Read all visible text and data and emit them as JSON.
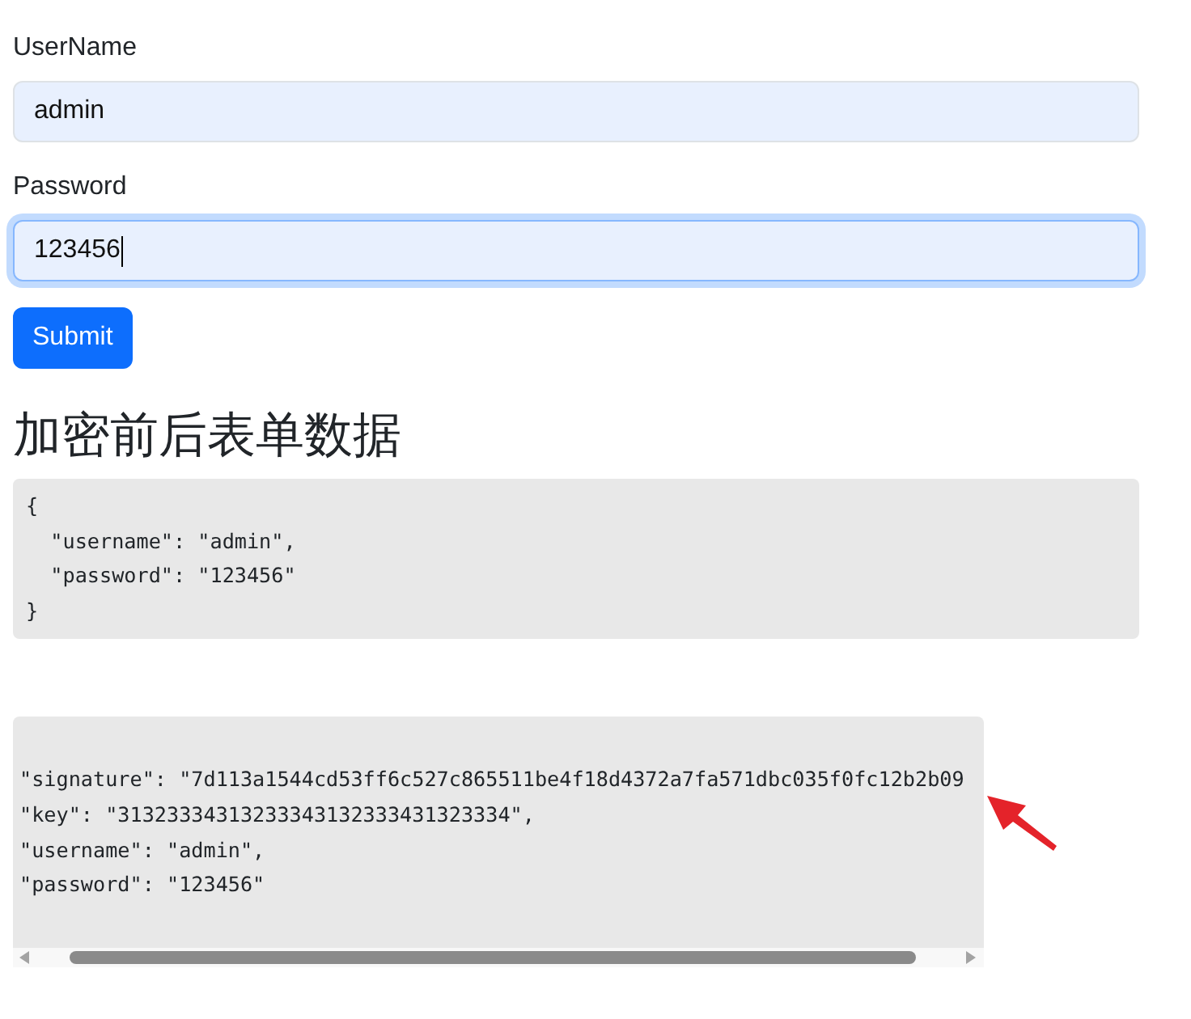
{
  "form": {
    "fields": [
      {
        "label": "UserName",
        "value": "admin",
        "focused": false
      },
      {
        "label": "Password",
        "value": "123456",
        "focused": true
      }
    ],
    "submit_button": "Submit"
  },
  "heading": "加密前后表单数据",
  "before_block": {
    "lines": [
      "{",
      "  \"username\": \"admin\",",
      "  \"password\": \"123456\"",
      "}"
    ]
  },
  "after_block": {
    "lines": [
      "\"signature\": \"7d113a1544cd53ff6c527c865511be4f18d4372a7fa571dbc035f0fc12b2b09",
      "\"key\": \"31323334313233343132333431323334\",",
      "\"username\": \"admin\",",
      "\"password\": \"123456\""
    ]
  }
}
